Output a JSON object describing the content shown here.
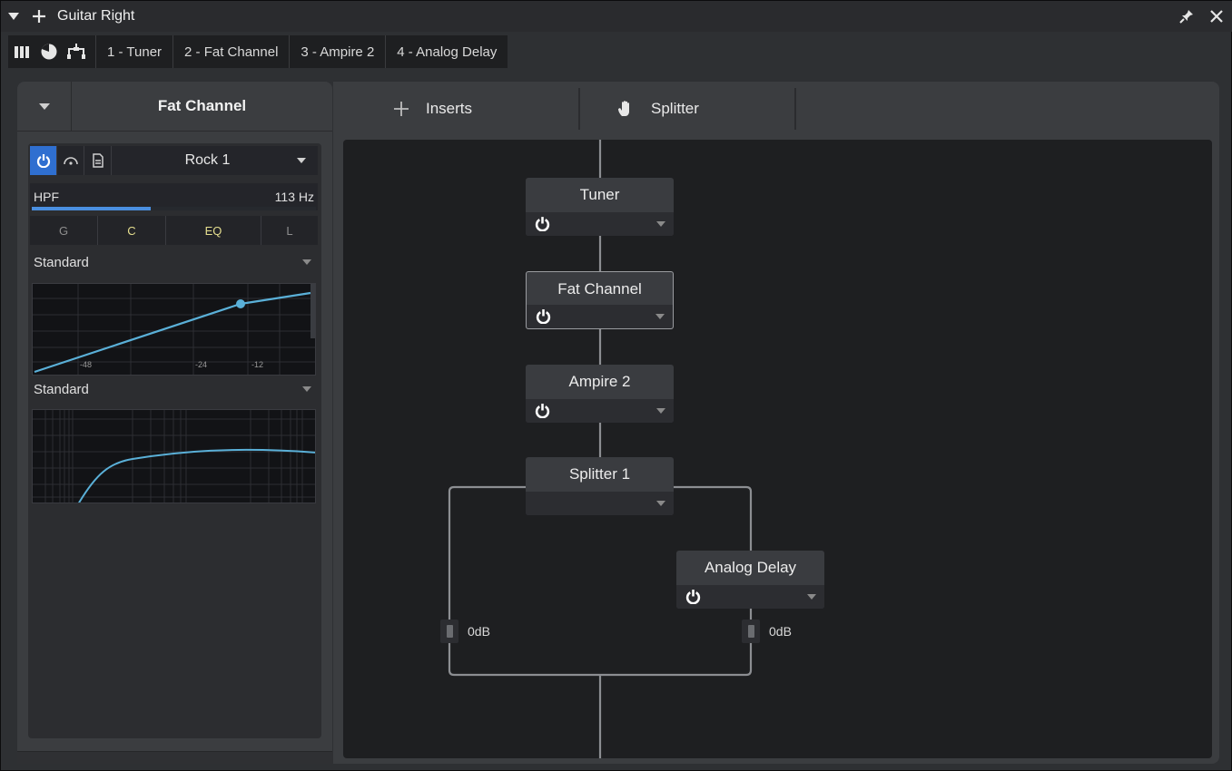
{
  "window": {
    "title": "Guitar Right"
  },
  "tabs": [
    {
      "label": "1 - Tuner"
    },
    {
      "label": "2 - Fat Channel"
    },
    {
      "label": "3 - Ampire 2"
    },
    {
      "label": "4 - Analog Delay"
    }
  ],
  "view_icons": [
    "mixer-view-icon",
    "pie-view-icon",
    "routing-view-icon"
  ],
  "left_panel": {
    "plugin_name": "Fat Channel",
    "preset": {
      "name": "Rock 1"
    },
    "hpf": {
      "label": "HPF",
      "value": "113 Hz",
      "level": 0.42
    },
    "modules": [
      {
        "label": "G",
        "active": false
      },
      {
        "label": "C",
        "active": true
      },
      {
        "label": "EQ",
        "active": true
      },
      {
        "label": "L",
        "active": false
      }
    ],
    "gate_mode": "Standard",
    "comp_graph": {
      "ticks": [
        "-48",
        "-24",
        "-12"
      ]
    },
    "eq_mode": "Standard"
  },
  "routing": {
    "inserts_label": "Inserts",
    "splitter_label": "Splitter",
    "nodes": [
      {
        "name": "Tuner",
        "has_power": true,
        "selected": false
      },
      {
        "name": "Fat Channel",
        "has_power": true,
        "selected": true
      },
      {
        "name": "Ampire 2",
        "has_power": true,
        "selected": false
      },
      {
        "name": "Splitter 1",
        "has_power": false,
        "selected": false
      },
      {
        "name": "Analog Delay",
        "has_power": true,
        "selected": false
      }
    ],
    "gains": [
      {
        "value": "0dB"
      },
      {
        "value": "0dB"
      }
    ]
  },
  "colors": {
    "accent_blue": "#2f6fd0",
    "graph_line": "#5ab0d8",
    "module_active": "#e6df8f"
  }
}
